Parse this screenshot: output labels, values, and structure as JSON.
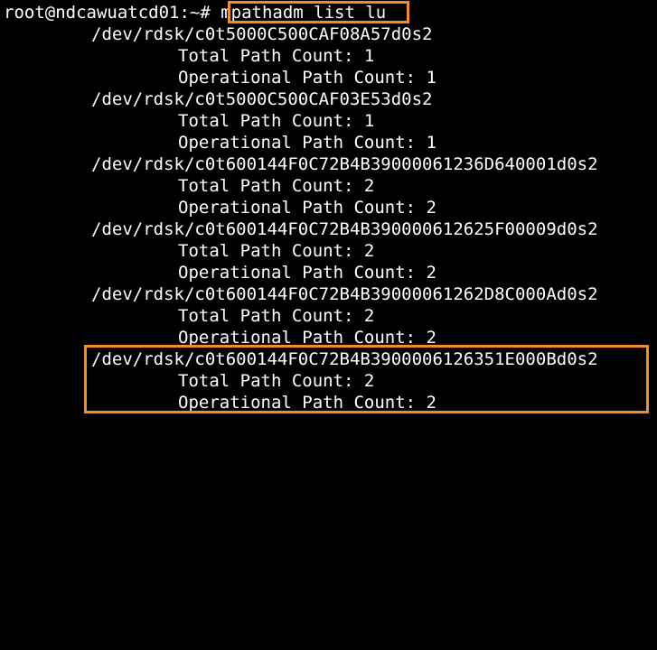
{
  "terminal": {
    "prompt": "root@ndcawuatcd01:~# ",
    "command": "mpathadm list lu",
    "highlight_color": "#f08c2a",
    "background": "#000000",
    "foreground": "#ffffff",
    "lus": [
      {
        "path": "/dev/rdsk/c0t5000C500CAF08A57d0s2",
        "total": "Total Path Count: 1",
        "operational": "Operational Path Count: 1"
      },
      {
        "path": "/dev/rdsk/c0t5000C500CAF03E53d0s2",
        "total": "Total Path Count: 1",
        "operational": "Operational Path Count: 1"
      },
      {
        "path": "/dev/rdsk/c0t600144F0C72B4B39000061236D640001d0s2",
        "total": "Total Path Count: 2",
        "operational": "Operational Path Count: 2"
      },
      {
        "path": "/dev/rdsk/c0t600144F0C72B4B390000612625F00009d0s2",
        "total": "Total Path Count: 2",
        "operational": "Operational Path Count: 2"
      },
      {
        "path": "/dev/rdsk/c0t600144F0C72B4B39000061262D8C000Ad0s2",
        "total": "Total Path Count: 2",
        "operational": "Operational Path Count: 2"
      },
      {
        "path": "/dev/rdsk/c0t600144F0C72B4B3900006126351E000Bd0s2",
        "total": "Total Path Count: 2",
        "operational": "Operational Path Count: 2"
      }
    ]
  }
}
